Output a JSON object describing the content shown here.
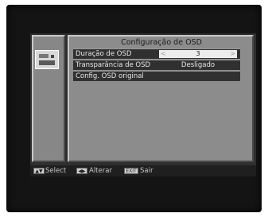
{
  "screen": {
    "title": "Configuração de OSD",
    "left_icon": "settings-box-icon"
  },
  "menu": {
    "items": [
      {
        "label": "Duração de OSD",
        "value": "3",
        "left_arrow": "<",
        "right_arrow": ">"
      },
      {
        "label": "Transparância de OSD",
        "value": "Desligado"
      },
      {
        "label": "Config. OSD original"
      }
    ]
  },
  "footer": {
    "select_key_icon": "up-down-key-icon",
    "select_label": "Select",
    "alter_key_icon": "left-right-key-icon",
    "alter_key_text": "◀▶",
    "alter_label": "Alterar",
    "exit_key_text": "EXIT",
    "exit_label": "Sair"
  },
  "colors": {
    "panel_gray": "#8c8c8c",
    "row_dark": "#303030",
    "value_box": "#ececec"
  }
}
